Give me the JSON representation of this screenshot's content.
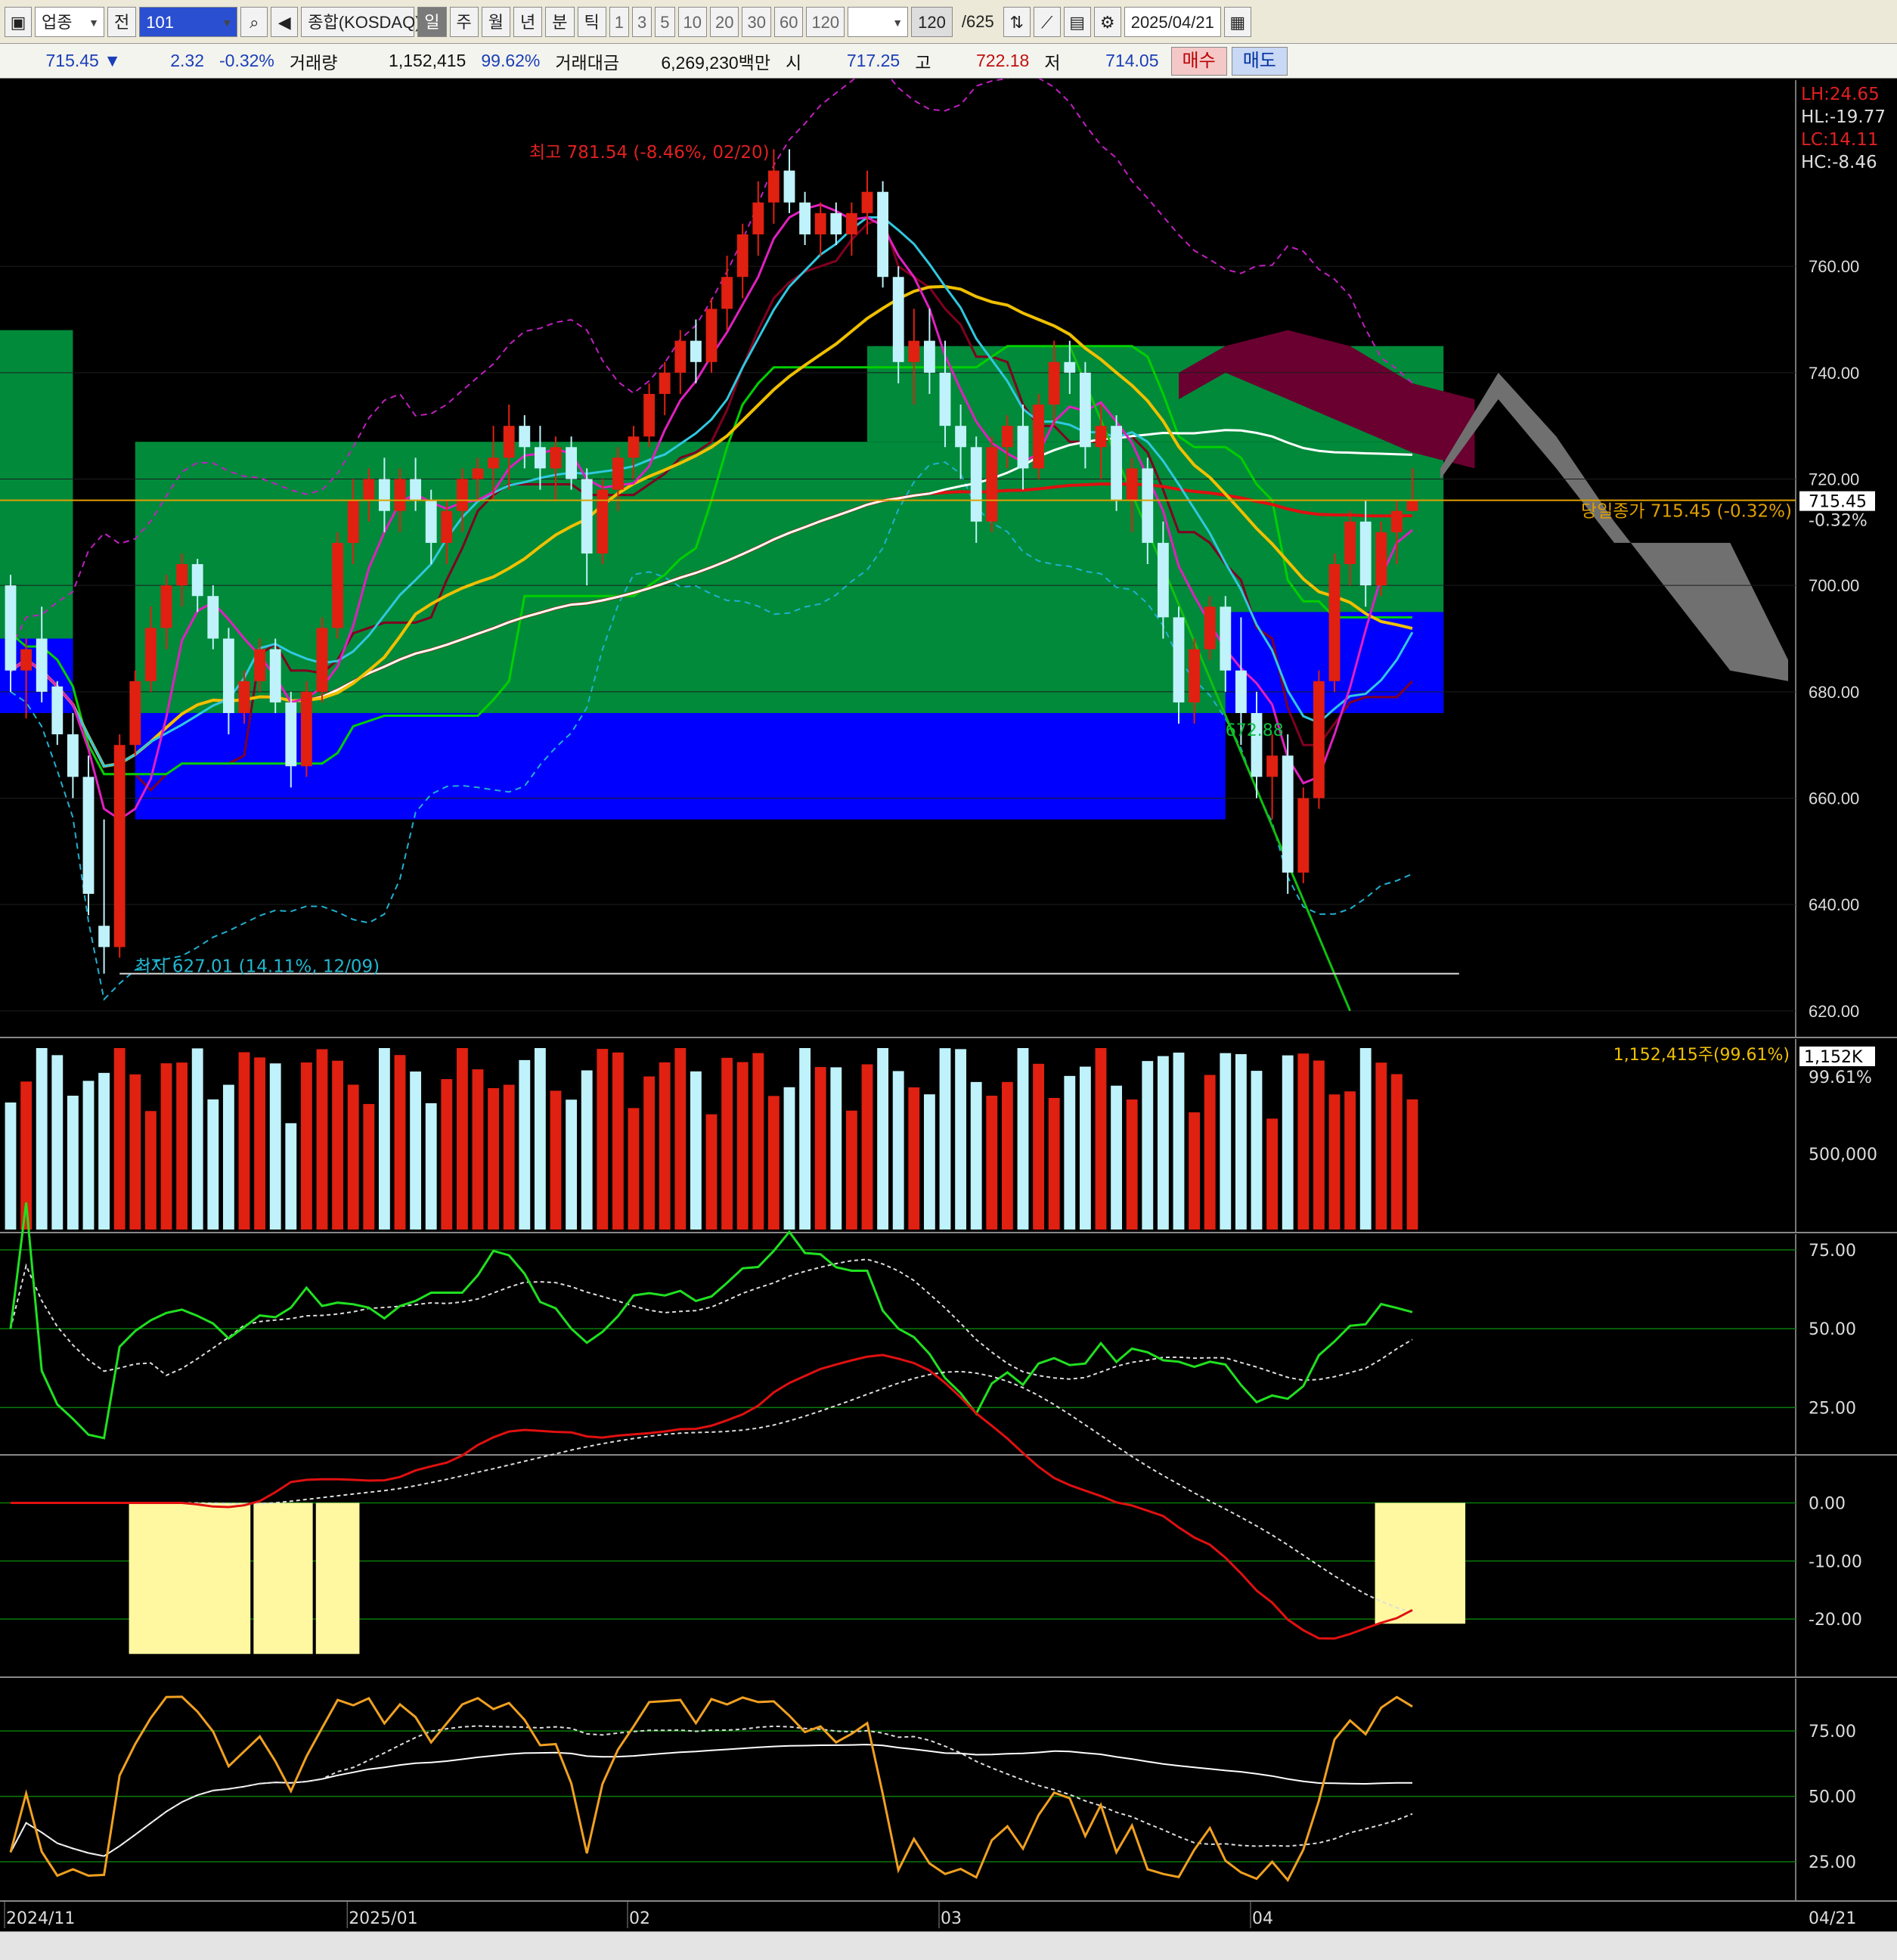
{
  "toolbar": {
    "category": "업종",
    "prev_label": "전",
    "code": "101",
    "market": "종합(KOSDAQ)",
    "periods": [
      "일",
      "주",
      "월",
      "년",
      "분",
      "틱"
    ],
    "intervals": [
      "1",
      "3",
      "5",
      "10",
      "20",
      "30",
      "60",
      "120"
    ],
    "count": "120",
    "total": "/625",
    "date": "2025/04/21"
  },
  "quote": {
    "price": "715.45 ▼",
    "change": "2.32",
    "change_pct": "-0.32%",
    "volume_label": "거래량",
    "volume": "1,152,415",
    "volume_pct": "99.62%",
    "amount_label": "거래대금",
    "amount": "6,269,230백만",
    "open_label": "시",
    "open": "717.25",
    "high_label": "고",
    "high": "722.18",
    "low_label": "저",
    "low": "714.05",
    "buy_label": "매수",
    "sell_label": "매도"
  },
  "colors": {
    "up": "#e02010",
    "down": "#bff2fa",
    "bg": "#000000",
    "ichimoku_green": "#008a3a",
    "ichimoku_blue": "#0000ff",
    "cloud_dark": "#6a0030",
    "cloud_gray": "#707070"
  },
  "chart_data": [
    {
      "type": "candlestick",
      "yticks": [
        620,
        640,
        660,
        680,
        700,
        720,
        740,
        760
      ],
      "ylim": [
        615,
        795
      ],
      "xlabels": [
        {
          "label": "2024/11",
          "i": 0
        },
        {
          "label": "2025/01",
          "i": 22
        },
        {
          "label": "02",
          "i": 40
        },
        {
          "label": "03",
          "i": 60
        },
        {
          "label": "04",
          "i": 80
        }
      ],
      "last_date": "04/21",
      "ohlc": [
        [
          700,
          702,
          680,
          684
        ],
        [
          684,
          690,
          675,
          688
        ],
        [
          690,
          696,
          678,
          680
        ],
        [
          681,
          682,
          670,
          672
        ],
        [
          672,
          676,
          660,
          664
        ],
        [
          664,
          668,
          638,
          642
        ],
        [
          636,
          656,
          627,
          632
        ],
        [
          632,
          672,
          630,
          670
        ],
        [
          670,
          684,
          668,
          682
        ],
        [
          682,
          696,
          680,
          692
        ],
        [
          692,
          702,
          688,
          700
        ],
        [
          700,
          706,
          696,
          704
        ],
        [
          704,
          705,
          695,
          698
        ],
        [
          698,
          700,
          688,
          690
        ],
        [
          690,
          692,
          672,
          676
        ],
        [
          676,
          684,
          674,
          682
        ],
        [
          682,
          690,
          680,
          688
        ],
        [
          688,
          690,
          676,
          678
        ],
        [
          678,
          680,
          662,
          666
        ],
        [
          666,
          682,
          664,
          680
        ],
        [
          680,
          694,
          678,
          692
        ],
        [
          692,
          710,
          690,
          708
        ],
        [
          708,
          720,
          704,
          716
        ],
        [
          716,
          722,
          712,
          720
        ],
        [
          720,
          724,
          710,
          714
        ],
        [
          714,
          722,
          710,
          720
        ],
        [
          720,
          724,
          714,
          716
        ],
        [
          716,
          718,
          704,
          708
        ],
        [
          708,
          716,
          704,
          714
        ],
        [
          714,
          722,
          710,
          720
        ],
        [
          720,
          724,
          716,
          722
        ],
        [
          722,
          730,
          716,
          724
        ],
        [
          724,
          734,
          718,
          730
        ],
        [
          730,
          732,
          722,
          726
        ],
        [
          726,
          730,
          718,
          722
        ],
        [
          722,
          728,
          716,
          726
        ],
        [
          726,
          728,
          718,
          720
        ],
        [
          720,
          722,
          700,
          706
        ],
        [
          706,
          720,
          704,
          718
        ],
        [
          718,
          726,
          714,
          724
        ],
        [
          724,
          730,
          720,
          728
        ],
        [
          728,
          738,
          726,
          736
        ],
        [
          736,
          742,
          732,
          740
        ],
        [
          740,
          748,
          736,
          746
        ],
        [
          746,
          750,
          738,
          742
        ],
        [
          742,
          754,
          740,
          752
        ],
        [
          752,
          762,
          748,
          758
        ],
        [
          758,
          768,
          754,
          766
        ],
        [
          766,
          776,
          762,
          772
        ],
        [
          772,
          782,
          768,
          778
        ],
        [
          778,
          782,
          770,
          772
        ],
        [
          772,
          774,
          764,
          766
        ],
        [
          766,
          772,
          762,
          770
        ],
        [
          770,
          772,
          764,
          766
        ],
        [
          766,
          772,
          762,
          770
        ],
        [
          770,
          778,
          766,
          774
        ],
        [
          774,
          776,
          756,
          758
        ],
        [
          758,
          760,
          738,
          742
        ],
        [
          742,
          752,
          734,
          746
        ],
        [
          746,
          752,
          736,
          740
        ],
        [
          740,
          746,
          726,
          730
        ],
        [
          730,
          734,
          720,
          726
        ],
        [
          726,
          728,
          708,
          712
        ],
        [
          712,
          728,
          710,
          726
        ],
        [
          726,
          732,
          722,
          730
        ],
        [
          730,
          734,
          718,
          722
        ],
        [
          722,
          736,
          720,
          734
        ],
        [
          734,
          746,
          730,
          742
        ],
        [
          742,
          746,
          736,
          740
        ],
        [
          740,
          742,
          722,
          726
        ],
        [
          726,
          734,
          720,
          730
        ],
        [
          730,
          732,
          714,
          716
        ],
        [
          716,
          724,
          710,
          722
        ],
        [
          722,
          724,
          704,
          708
        ],
        [
          708,
          712,
          690,
          694
        ],
        [
          694,
          696,
          674,
          678
        ],
        [
          678,
          690,
          674,
          688
        ],
        [
          688,
          698,
          686,
          696
        ],
        [
          696,
          698,
          680,
          684
        ],
        [
          684,
          694,
          670,
          676
        ],
        [
          676,
          680,
          660,
          664
        ],
        [
          664,
          672,
          656,
          668
        ],
        [
          668,
          672,
          642,
          646
        ],
        [
          646,
          662,
          644,
          660
        ],
        [
          660,
          684,
          658,
          682
        ],
        [
          682,
          706,
          680,
          704
        ],
        [
          704,
          714,
          700,
          712
        ],
        [
          712,
          716,
          696,
          700
        ],
        [
          700,
          712,
          698,
          710
        ],
        [
          710,
          716,
          704,
          714
        ],
        [
          714,
          722,
          714,
          716
        ]
      ],
      "annotations": {
        "high": "최고 781.54 (-8.46%, 02/20)",
        "low": "최저 627.01 (14.11%, 12/09)",
        "level": "672.88",
        "close_label": "당일종가 715.45 (-0.32%)",
        "close_value": "715.45",
        "close_pct": "-0.32%",
        "lh": "LH:24.65",
        "hl": "HL:-19.77",
        "lc": "LC:14.11",
        "hc": "HC:-8.46"
      }
    },
    {
      "type": "bar",
      "title": "1,152,415주(99.61%)",
      "last_value": "1,152K",
      "last_pct": "99.61%",
      "ytick": "500,000"
    },
    {
      "type": "line",
      "yticks": [
        25,
        50,
        75
      ],
      "ylim": [
        10,
        80
      ]
    },
    {
      "type": "line",
      "yticks": [
        0,
        -10,
        -20
      ],
      "ylim": [
        -30,
        8
      ]
    },
    {
      "type": "line",
      "yticks": [
        25,
        50,
        75
      ],
      "ylim": [
        10,
        95
      ]
    }
  ]
}
